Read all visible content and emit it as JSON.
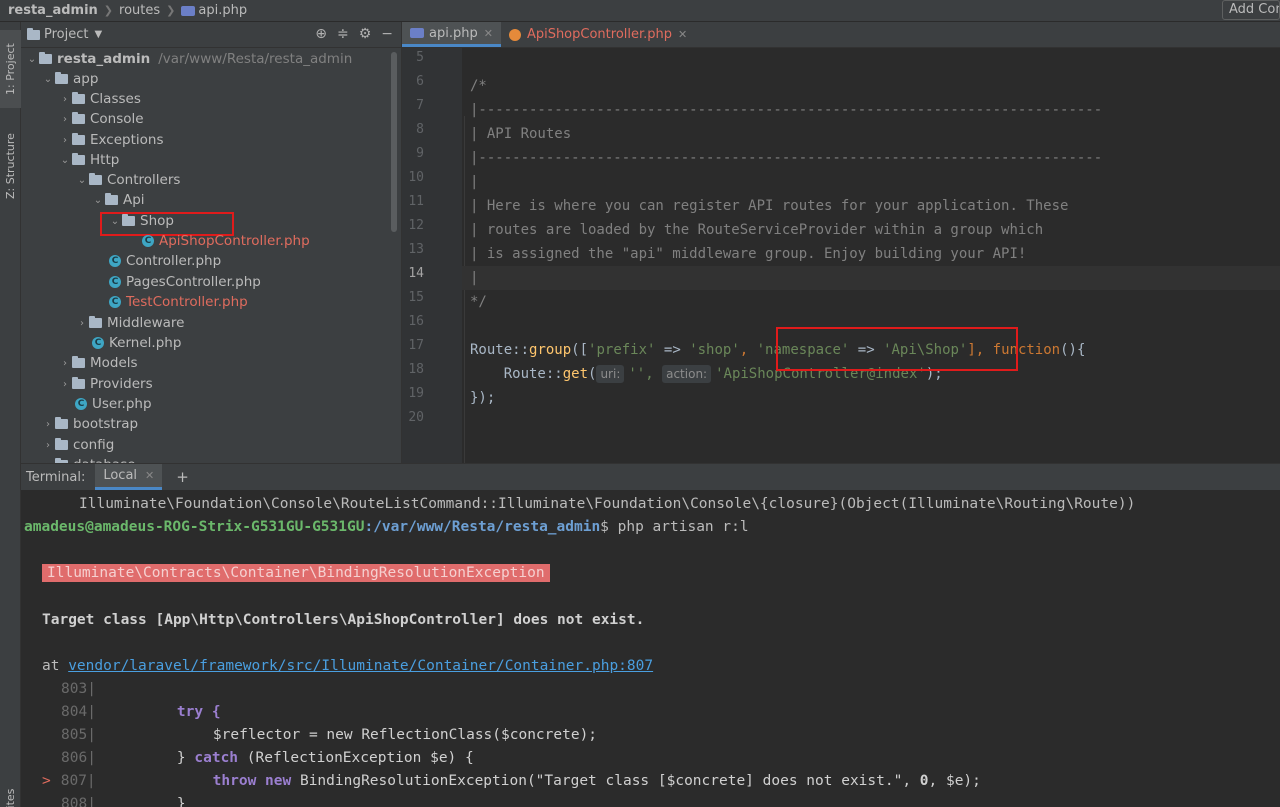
{
  "topbar": {
    "crumb_project": "resta_admin",
    "crumb_folder": "routes",
    "crumb_file": "api.php",
    "add_config_button": "Add Configuration..."
  },
  "leftstrip": {
    "project_tab": "1: Project",
    "structure_tab": "Z: Structure",
    "favorites_tab": "rites"
  },
  "project_panel": {
    "title": "Project",
    "root_name": "resta_admin",
    "root_path": "/var/www/Resta/resta_admin",
    "items": {
      "app": "app",
      "classes": "Classes",
      "console": "Console",
      "exceptions": "Exceptions",
      "http": "Http",
      "controllers": "Controllers",
      "api": "Api",
      "shop": "Shop",
      "apishopcontroller": "ApiShopController.php",
      "controller": "Controller.php",
      "pagescontroller": "PagesController.php",
      "testcontroller": "TestController.php",
      "middleware": "Middleware",
      "kernel": "Kernel.php",
      "models": "Models",
      "providers": "Providers",
      "user": "User.php",
      "bootstrap": "bootstrap",
      "config": "config",
      "database": "database"
    }
  },
  "editor": {
    "tabs": [
      {
        "label": "api.php"
      },
      {
        "label": "ApiShopController.php"
      }
    ],
    "line_numbers": [
      "5",
      "6",
      "7",
      "8",
      "9",
      "10",
      "11",
      "12",
      "13",
      "14",
      "15",
      "16",
      "17",
      "18",
      "19",
      "20"
    ],
    "current_line": "14",
    "code": {
      "l6": "/*",
      "l7": "|--------------------------------------------------------------------------",
      "l8": "| API Routes",
      "l9": "|--------------------------------------------------------------------------",
      "l10": "|",
      "l11": "| Here is where you can register API routes for your application. These",
      "l12": "| routes are loaded by the RouteServiceProvider within a group which",
      "l13": "| is assigned the \"api\" middleware group. Enjoy building your API!",
      "l14": "|",
      "l15": "*/",
      "l17_a": "Route::",
      "l17_b": "group",
      "l17_c": "([",
      "l17_d": "'prefix'",
      "l17_e": " => ",
      "l17_f": "'shop'",
      "l17_g": ", ",
      "l17_h": "'namespace'",
      "l17_i": " => ",
      "l17_j": "'Api\\Shop'",
      "l17_k": "], ",
      "l17_l": "function",
      "l17_m": "(){",
      "l18_a": "    Route::",
      "l18_b": "get",
      "l18_c": "(",
      "l18_hint1": "uri:",
      "l18_d": "'',",
      "l18_hint2": "action:",
      "l18_e": "'ApiShopController@index'",
      "l18_f": ");",
      "l19": "});"
    }
  },
  "terminal": {
    "label": "Terminal:",
    "tab": "Local",
    "plus": "+",
    "lines": {
      "closure": "Illuminate\\Foundation\\Console\\RouteListCommand::Illuminate\\Foundation\\Console\\{closure}(Object(Illuminate\\Routing\\Route))",
      "prompt_user": "amadeus@amadeus-ROG-Strix-G531GU-G531GU",
      "prompt_path": ":/var/www/Resta/resta_admin",
      "command": "$ php artisan r:l",
      "exception": "Illuminate\\Contracts\\Container\\BindingResolutionException",
      "message": "Target class [App\\Http\\Controllers\\ApiShopController] does not exist.",
      "at": "at ",
      "at_link": "vendor/laravel/framework/src/Illuminate/Container/Container.php:807",
      "n803": "803|",
      "n804": "804|",
      "c804": "try {",
      "n805": "805|",
      "c805": "$reflector = new ReflectionClass($concrete);",
      "n806": "806|",
      "c806a": "} ",
      "c806b": "catch",
      "c806c": " (ReflectionException $e) {",
      "marker807": ">",
      "n807": "807|",
      "c807a": "throw new ",
      "c807b": "BindingResolutionException(\"Target class [$concrete] does not exist.\", ",
      "c807c": "0",
      "c807d": ", $e);",
      "n808": "808|",
      "c808": "}"
    }
  }
}
